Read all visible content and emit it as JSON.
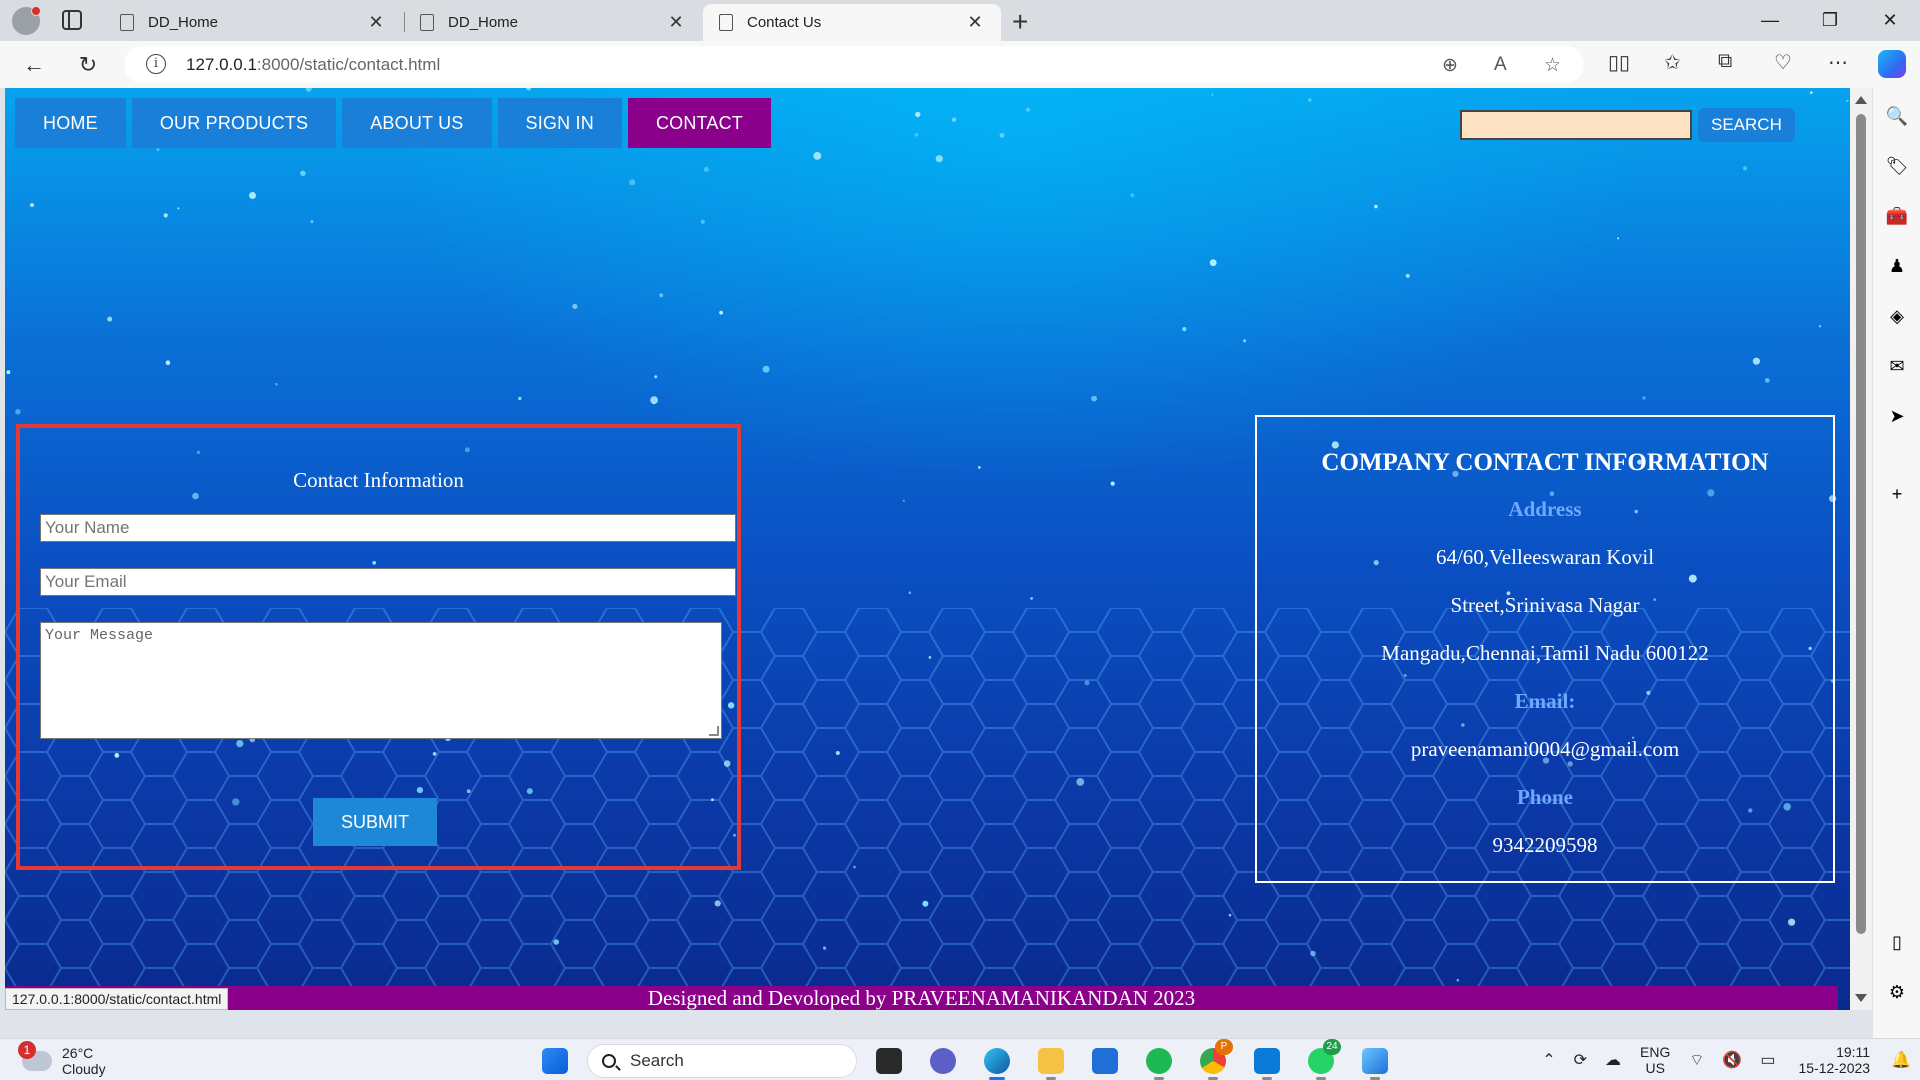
{
  "browser": {
    "tabs": [
      {
        "title": "DD_Home",
        "active": false
      },
      {
        "title": "DD_Home",
        "active": false
      },
      {
        "title": "Contact Us",
        "active": true
      }
    ],
    "url_host": "127.0.0.1",
    "url_rest": ":8000/static/contact.html",
    "status_url": "127.0.0.1:8000/static/contact.html"
  },
  "nav": {
    "items": [
      "HOME",
      "OUR PRODUCTS",
      "ABOUT US",
      "SIGN IN",
      "CONTACT"
    ],
    "active": "CONTACT",
    "search_value": "",
    "search_button": "SEARCH"
  },
  "form": {
    "title": "Contact Information",
    "name_placeholder": "Your Name",
    "email_placeholder": "Your Email",
    "message_placeholder": "Your Message",
    "submit": "SUBMIT"
  },
  "company": {
    "heading": "COMPANY CONTACT INFORMATION",
    "address_label": "Address",
    "address_line1": "64/60,Velleeswaran Kovil",
    "address_line2": "Street,Srinivasa Nagar",
    "address_line3": "Mangadu,Chennai,Tamil Nadu 600122",
    "email_label": "Email:",
    "email": "praveenamani0004@gmail.com",
    "phone_label": "Phone",
    "phone": "9342209598"
  },
  "footer": "Designed and Devoloped by PRAVEENAMANIKANDAN 2023",
  "taskbar": {
    "weather_temp": "26°C",
    "weather_desc": "Cloudy",
    "weather_alert": "1",
    "search": "Search",
    "badge_p": "P",
    "badge_whatsapp": "24",
    "lang1": "ENG",
    "lang2": "US",
    "time": "19:11",
    "date": "15-12-2023"
  },
  "colors": {
    "nav_button": "#1a7fd8",
    "nav_active": "#8b008b",
    "form_border": "#e53935",
    "label_blue": "#6fa8ff",
    "footer_bg": "#8b008b"
  }
}
